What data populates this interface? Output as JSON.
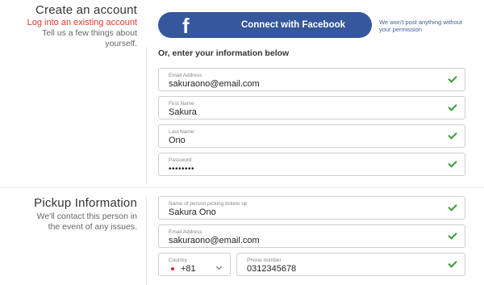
{
  "account": {
    "title": "Create an account",
    "login_link": "Log into an existing account",
    "description_line1": "Tell us a few things about",
    "description_line2": "yourself."
  },
  "facebook": {
    "icon": "f",
    "button_label": "Connect with Facebook",
    "note_line1": "We won't post anything without",
    "note_line2": "your permission"
  },
  "form": {
    "or_label": "Or, enter your information below",
    "email": {
      "label": "Email Address",
      "value": "sakuraono@email.com"
    },
    "first_name": {
      "label": "First Name",
      "value": "Sakura"
    },
    "last_name": {
      "label": "Last Name",
      "value": "Ono"
    },
    "password": {
      "label": "Password",
      "value": "••••••••"
    }
  },
  "pickup": {
    "title": "Pickup Information",
    "description_line1": "We'll contact this person in",
    "description_line2": "the event of any issues.",
    "name": {
      "label": "Name of person picking tickets up",
      "value": "Sakura Ono"
    },
    "email": {
      "label": "Email Address",
      "value": "sakuraono@email.com"
    },
    "country": {
      "label": "Country",
      "value": "+81"
    },
    "phone": {
      "label": "Phone number",
      "value": "0312345678"
    }
  },
  "colors": {
    "facebook_blue": "#35579d",
    "link_red": "#e03a30",
    "check_green": "#3a9a3a"
  },
  "icons": {
    "facebook": "facebook-logo-icon",
    "valid": "checkmark-icon",
    "flag": "japan-flag-icon",
    "dropdown": "chevron-down-icon"
  }
}
